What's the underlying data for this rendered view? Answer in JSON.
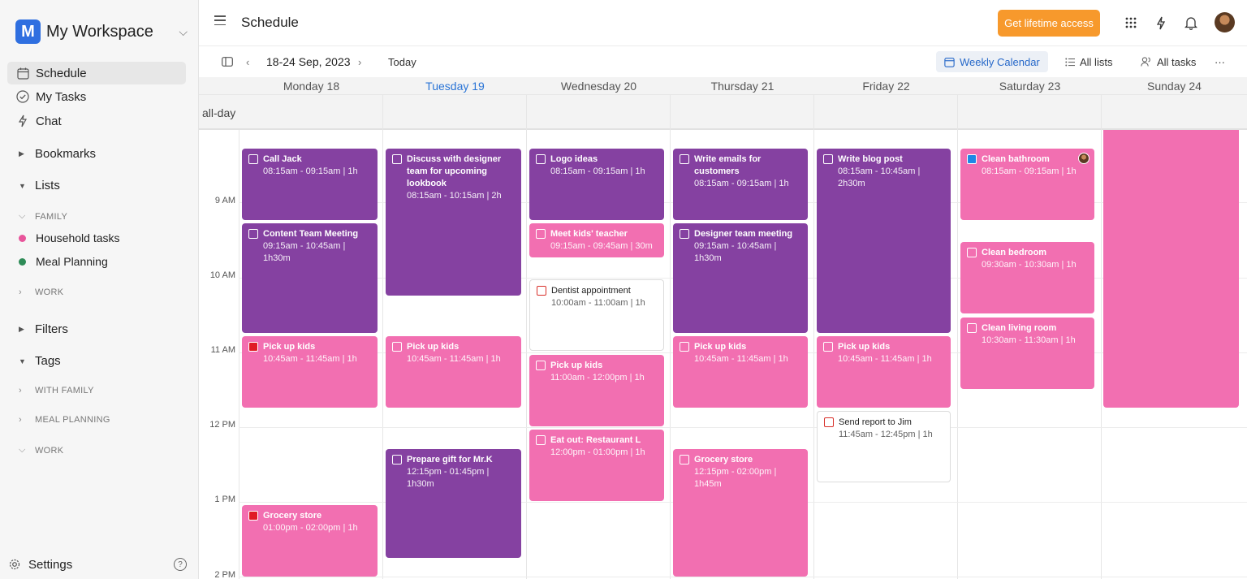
{
  "workspace": {
    "logo_letter": "M",
    "name": "My Workspace"
  },
  "nav": [
    {
      "label": "Schedule",
      "icon": "calendar-icon"
    },
    {
      "label": "My Tasks",
      "icon": "check-circle-icon"
    },
    {
      "label": "Chat",
      "icon": "bolt-icon"
    }
  ],
  "sections": {
    "bookmarks": "Bookmarks",
    "lists": "Lists",
    "family": "FAMILY",
    "household": "Household tasks",
    "meal": "Meal Planning",
    "work": "WORK",
    "filters": "Filters",
    "tags": "Tags",
    "with_family": "WITH FAMILY",
    "meal_planning": "MEAL PLANNING",
    "work_tag": "WORK"
  },
  "colors": {
    "household": "#e8559b",
    "meal": "#2e8b57",
    "accent": "#f7992c",
    "purple": "#8541a1",
    "pink": "#f26fb1"
  },
  "settings": {
    "label": "Settings",
    "help": "?"
  },
  "header": {
    "title": "Schedule",
    "cta": "Get lifetime access"
  },
  "toolbar": {
    "range": "18-24 Sep, 2023",
    "today": "Today",
    "weekly": "Weekly Calendar",
    "all_lists": "All lists",
    "all_tasks": "All tasks",
    "more": "···"
  },
  "days": [
    "Monday 18",
    "Tuesday 19",
    "Wednesday 20",
    "Thursday 21",
    "Friday 22",
    "Saturday 23",
    "Sunday 24"
  ],
  "allday_label": "all-day",
  "times": [
    "9 AM",
    "10 AM",
    "11 AM",
    "12 PM",
    "1 PM",
    "2 PM"
  ],
  "events": {
    "mon1": {
      "title": "Call Jack",
      "sub": "08:15am - 09:15am | 1h"
    },
    "mon2": {
      "title": "Content Team Meeting",
      "sub": "09:15am - 10:45am | 1h30m"
    },
    "mon3": {
      "title": "Pick up kids",
      "sub": "10:45am - 11:45am | 1h"
    },
    "mon4": {
      "title": "Grocery store",
      "sub": "01:00pm - 02:00pm | 1h"
    },
    "tue1": {
      "title": "Discuss with designer team for upcoming lookbook",
      "sub": "08:15am - 10:15am | 2h"
    },
    "tue2": {
      "title": "Pick up kids",
      "sub": "10:45am - 11:45am | 1h"
    },
    "tue3": {
      "title": "Prepare gift for Mr.K",
      "sub": "12:15pm - 01:45pm | 1h30m"
    },
    "wed1": {
      "title": "Logo ideas",
      "sub": "08:15am - 09:15am | 1h"
    },
    "wed2": {
      "title": "Meet kids' teacher",
      "sub": "09:15am - 09:45am | 30m"
    },
    "wed3": {
      "title": "Dentist appointment",
      "sub": "10:00am - 11:00am | 1h"
    },
    "wed4": {
      "title": "Pick up kids",
      "sub": "11:00am - 12:00pm | 1h"
    },
    "wed5": {
      "title": "Eat out: Restaurant L",
      "sub": "12:00pm - 01:00pm | 1h"
    },
    "thu1": {
      "title": "Write emails for customers",
      "sub": "08:15am - 09:15am | 1h"
    },
    "thu2": {
      "title": "Designer team meeting",
      "sub": "09:15am - 10:45am | 1h30m"
    },
    "thu3": {
      "title": "Pick up kids",
      "sub": "10:45am - 11:45am | 1h"
    },
    "thu4": {
      "title": "Grocery store",
      "sub": "12:15pm - 02:00pm | 1h45m"
    },
    "fri1": {
      "title": "Write blog post",
      "sub": "08:15am - 10:45am | 2h30m"
    },
    "fri2": {
      "title": "Pick up kids",
      "sub": "10:45am - 11:45am | 1h"
    },
    "fri3": {
      "title": "Send report to Jim",
      "sub": "11:45am - 12:45pm | 1h"
    },
    "sat1": {
      "title": "Clean bathroom",
      "sub": "08:15am - 09:15am | 1h"
    },
    "sat2": {
      "title": "Clean bedroom",
      "sub": "09:30am - 10:30am | 1h"
    },
    "sat3": {
      "title": "Clean living room",
      "sub": "10:30am - 11:30am | 1h"
    }
  }
}
